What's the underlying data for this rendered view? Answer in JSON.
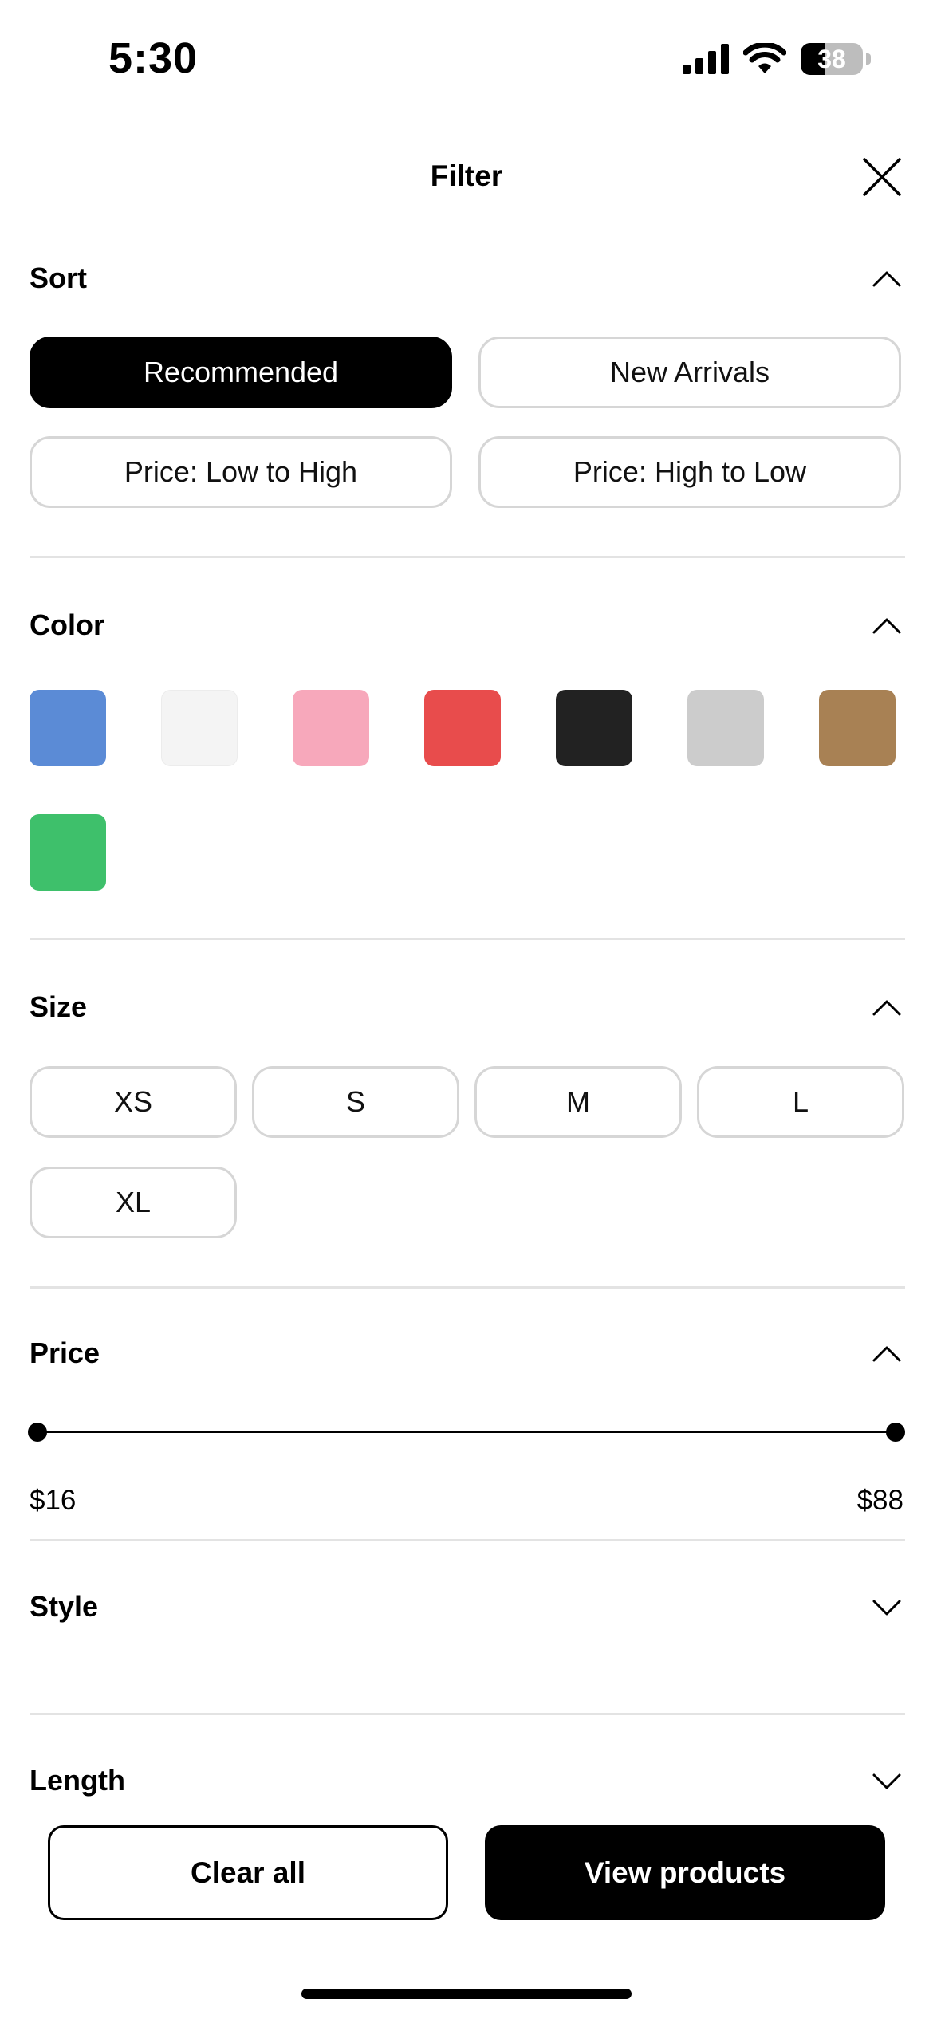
{
  "status_bar": {
    "time": "5:30",
    "battery": "38",
    "icons": [
      "cellular-signal-icon",
      "wifi-icon",
      "battery-icon"
    ]
  },
  "header": {
    "title": "Filter",
    "close_icon": "close-icon"
  },
  "sort": {
    "title": "Sort",
    "options": [
      "Recommended",
      "New Arrivals",
      "Price: Low to High",
      "Price: High to Low"
    ],
    "selected": "Recommended"
  },
  "color": {
    "title": "Color",
    "swatches": [
      "#5b8bd6",
      "#f4f4f4",
      "#f7a8bb",
      "#e84c4c",
      "#222222",
      "#cccccc",
      "#a88154",
      "#3ec06b"
    ]
  },
  "size": {
    "title": "Size",
    "options": [
      "XS",
      "S",
      "M",
      "L",
      "XL"
    ]
  },
  "price": {
    "title": "Price",
    "min_label": "$16",
    "max_label": "$88",
    "range_fraction": [
      0,
      1
    ]
  },
  "style": {
    "title": "Style"
  },
  "length": {
    "title": "Length"
  },
  "footer": {
    "clear_label": "Clear all",
    "view_label": "View products"
  }
}
